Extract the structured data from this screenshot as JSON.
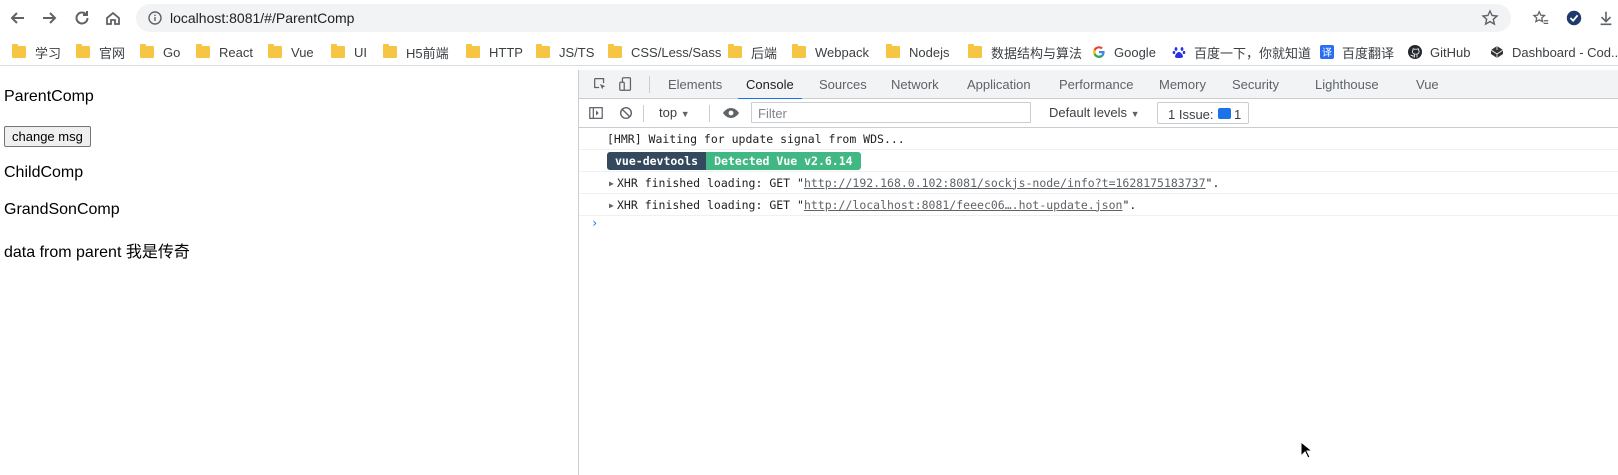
{
  "browser": {
    "url": "localhost:8081/#/ParentComp"
  },
  "bookmarks": [
    {
      "label": "学习",
      "icon": "folder-icon"
    },
    {
      "label": "官网",
      "icon": "folder-icon"
    },
    {
      "label": "Go",
      "icon": "folder-icon"
    },
    {
      "label": "React",
      "icon": "folder-icon"
    },
    {
      "label": "Vue",
      "icon": "folder-icon"
    },
    {
      "label": "UI",
      "icon": "folder-icon"
    },
    {
      "label": "H5前端",
      "icon": "folder-icon"
    },
    {
      "label": "HTTP",
      "icon": "folder-icon"
    },
    {
      "label": "JS/TS",
      "icon": "folder-icon"
    },
    {
      "label": "CSS/Less/Sass",
      "icon": "folder-icon"
    },
    {
      "label": "后端",
      "icon": "folder-icon"
    },
    {
      "label": "Webpack",
      "icon": "folder-icon"
    },
    {
      "label": "Nodejs",
      "icon": "folder-icon"
    },
    {
      "label": "数据结构与算法",
      "icon": "folder-icon"
    },
    {
      "label": "Google",
      "icon": "google-icon"
    },
    {
      "label": "百度一下，你就知道",
      "icon": "baidu-icon"
    },
    {
      "label": "百度翻译",
      "icon": "translate-icon"
    },
    {
      "label": "GitHub",
      "icon": "github-icon"
    },
    {
      "label": "Dashboard - Cod...",
      "icon": "codepen-icon"
    }
  ],
  "page": {
    "parent_title": "ParentComp",
    "button_label": "change msg",
    "child_title": "ChildComp",
    "grandson_title": "GrandSonComp",
    "data_text": "data from parent 我是传奇"
  },
  "devtools": {
    "tabs": [
      "Elements",
      "Console",
      "Sources",
      "Network",
      "Application",
      "Performance",
      "Memory",
      "Security",
      "Lighthouse",
      "Vue"
    ],
    "active_tab": "Console",
    "context": "top",
    "filter_placeholder": "Filter",
    "levels": "Default levels",
    "issues_label": "1 Issue:",
    "issues_count": "1",
    "accent": "#1a73e8"
  },
  "console": {
    "hmr": "[HMR] Waiting for update signal from WDS...",
    "badge_left": "vue-devtools",
    "badge_right": "Detected Vue v2.6.14",
    "xhr1_prefix": "XHR finished loading: GET \"",
    "xhr1_link": "http://192.168.0.102:8081/sockjs-node/info?t=1628175183737",
    "xhr1_suffix": "\".",
    "xhr2_prefix": "XHR finished loading: GET \"",
    "xhr2_link": "http://localhost:8081/feeec06….hot-update.json",
    "xhr2_suffix": "\".",
    "badge_colors": {
      "dark": "#35495e",
      "green": "#41b883"
    }
  }
}
